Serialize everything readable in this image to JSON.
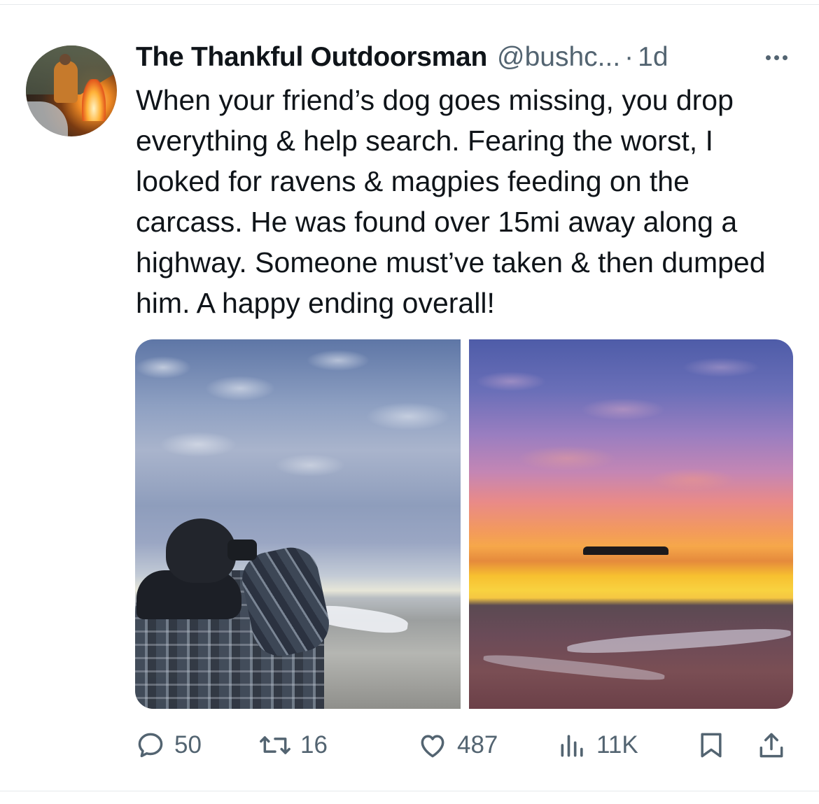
{
  "tweet": {
    "display_name": "The Thankful Outdoorsman",
    "handle": "@bushc...",
    "separator": "·",
    "time": "1d",
    "text": "When your friend’s dog goes missing, you drop everything & help search. Fearing the worst, I looked for ravens & magpies feeding on the carcass. He was found over 15mi away along a highway. Someone must’ve taken & then dumped him. A happy ending overall!"
  },
  "actions": {
    "replies": "50",
    "retweets": "16",
    "likes": "487",
    "views": "11K"
  },
  "icons": {
    "reply": "reply-icon",
    "retweet": "retweet-icon",
    "like": "heart-icon",
    "views": "views-icon",
    "bookmark": "bookmark-icon",
    "share": "share-icon",
    "more": "more-options-icon"
  },
  "colors": {
    "text_primary": "#0f1419",
    "text_secondary": "#536471",
    "divider": "#e6e9ec"
  }
}
